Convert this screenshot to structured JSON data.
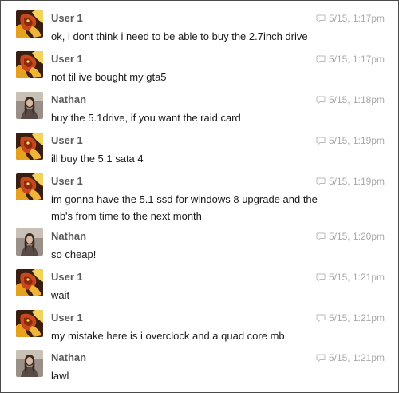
{
  "messages": [
    {
      "author": "User 1",
      "time": "5/15, 1:17pm",
      "text": "ok, i dont think i need to be able to buy the 2.7inch drive",
      "avatar": "dragon-avatar"
    },
    {
      "author": "User 1",
      "time": "5/15, 1:17pm",
      "text": "not til ive bought my gta5",
      "avatar": "dragon-avatar"
    },
    {
      "author": "Nathan",
      "time": "5/15, 1:18pm",
      "text": "buy the 5.1drive, if you want the raid card",
      "avatar": "person-avatar"
    },
    {
      "author": "User 1",
      "time": "5/15, 1:19pm",
      "text": "ill buy the 5.1 sata 4",
      "avatar": "dragon-avatar"
    },
    {
      "author": "User 1",
      "time": "5/15, 1:19pm",
      "text": "im gonna have the 5.1 ssd for windows 8 upgrade and the mb's from time to the next month",
      "avatar": "dragon-avatar"
    },
    {
      "author": "Nathan",
      "time": "5/15, 1:20pm",
      "text": "so cheap!",
      "avatar": "person-avatar"
    },
    {
      "author": "User 1",
      "time": "5/15, 1:21pm",
      "text": "wait",
      "avatar": "dragon-avatar"
    },
    {
      "author": "User 1",
      "time": "5/15, 1:21pm",
      "text": "my mistake here is i overclock and a quad core mb",
      "avatar": "dragon-avatar"
    },
    {
      "author": "Nathan",
      "time": "5/15, 1:21pm",
      "text": "lawl",
      "avatar": "person-avatar"
    }
  ],
  "icons": {
    "reply": "speech-bubble-icon"
  },
  "colors": {
    "author": "#5a5a5a",
    "timestamp": "#a8a8a8",
    "text": "#1a1a1a",
    "border": "#4a4a4a"
  }
}
